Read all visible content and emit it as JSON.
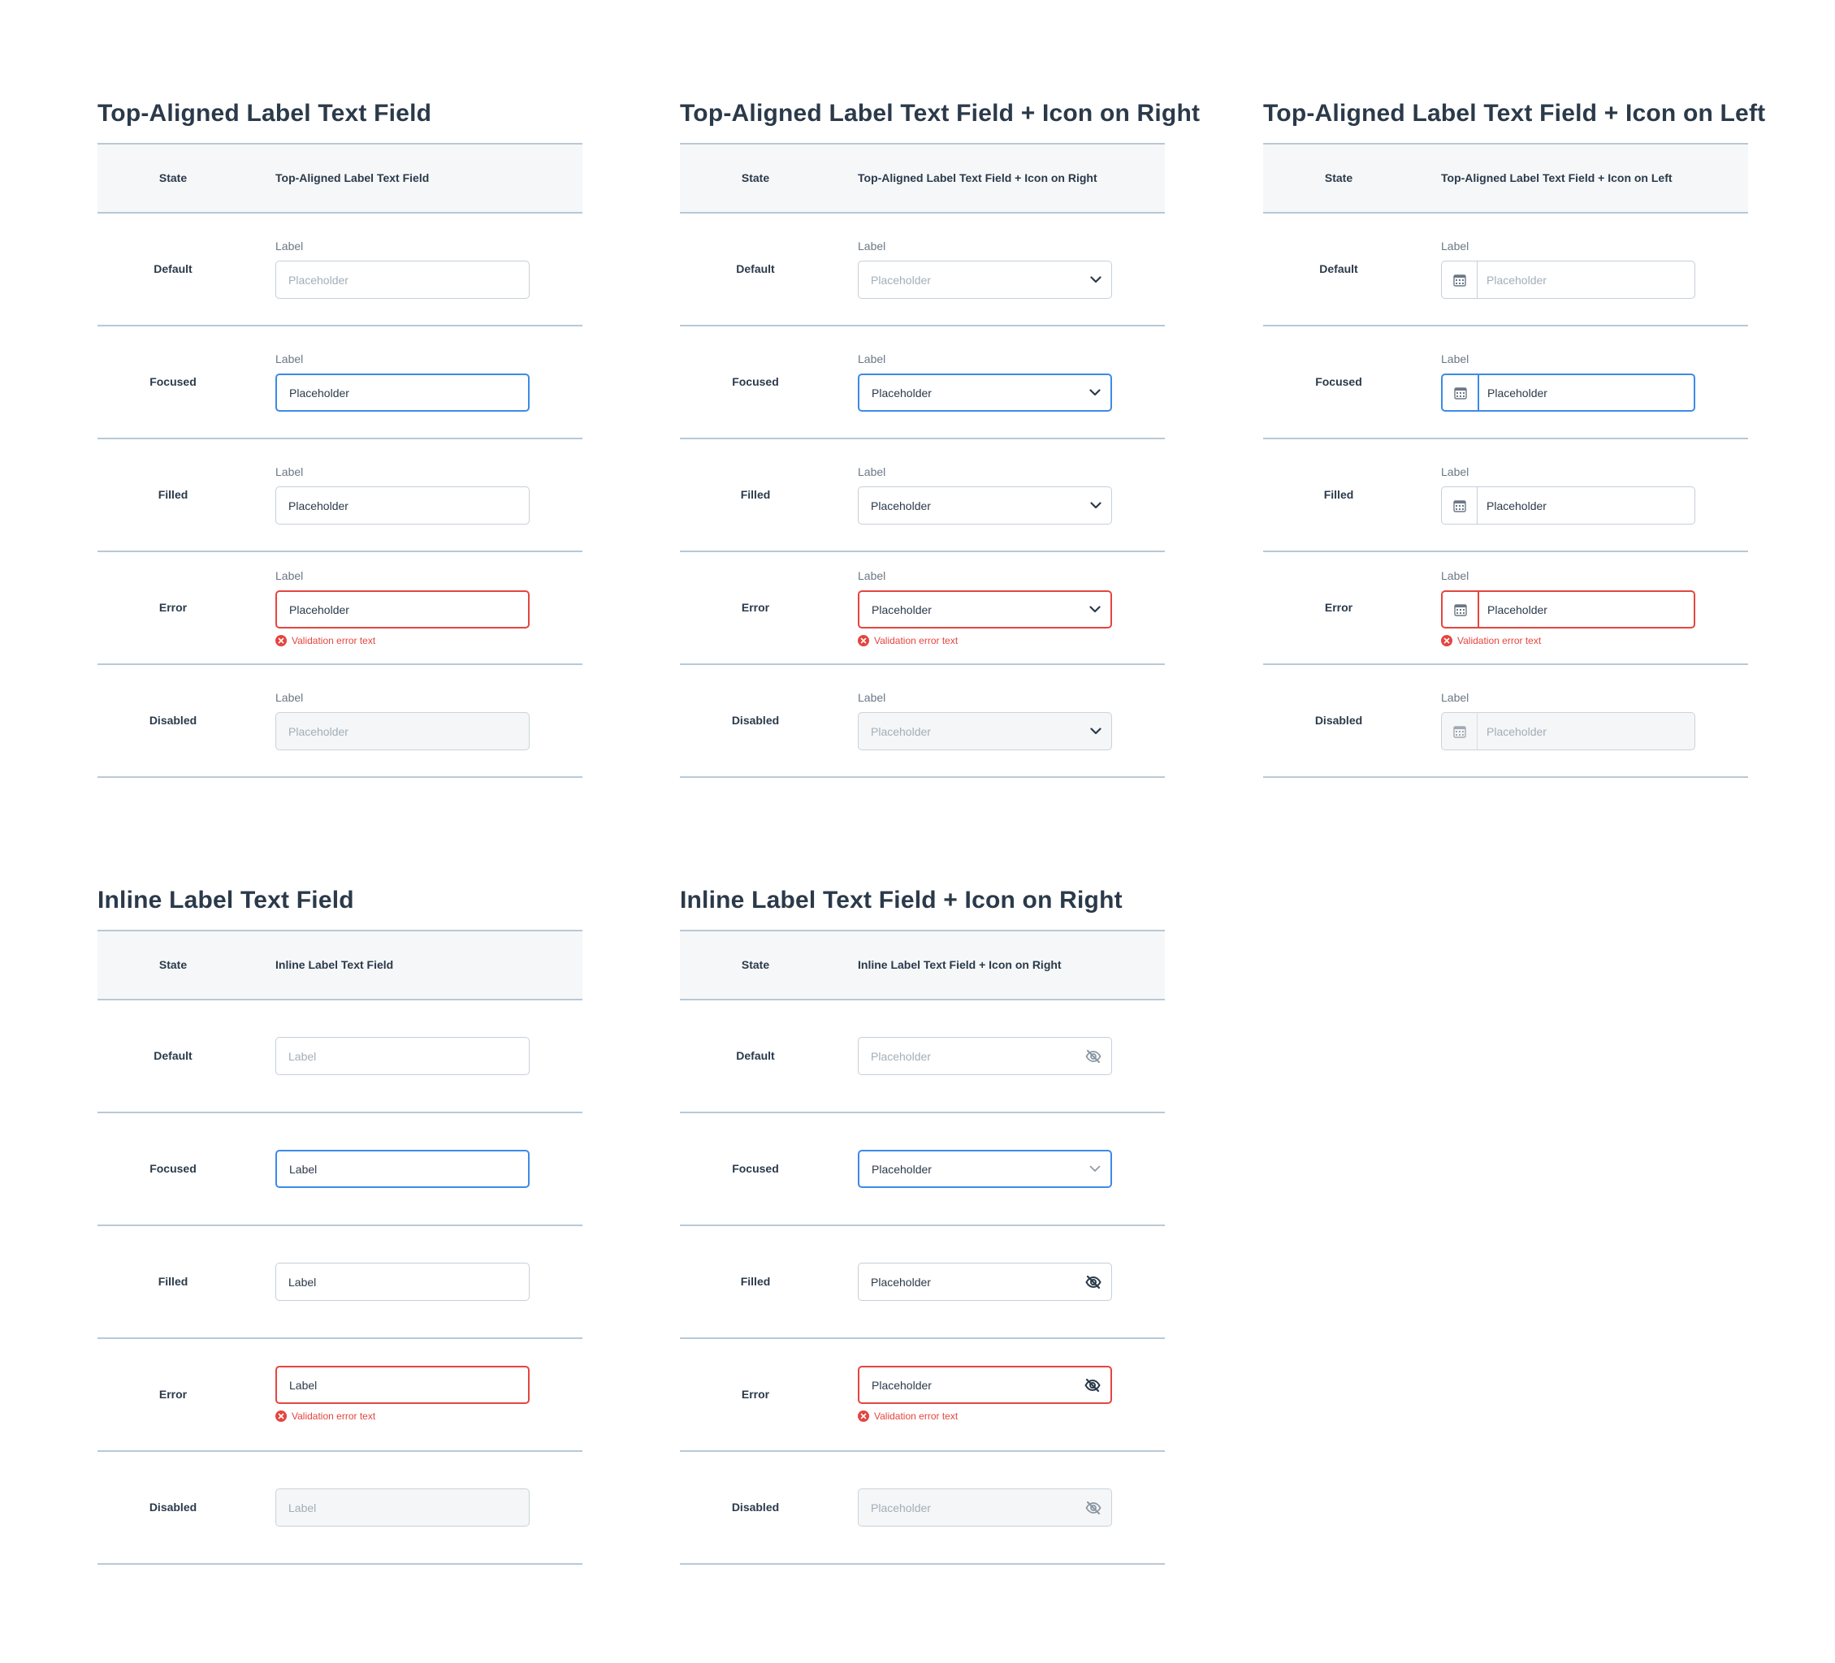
{
  "colors": {
    "focus": "#3c8ae8",
    "error": "#e4453f",
    "border": "#c6cfd8",
    "divider": "#b8c9d8",
    "header_bg": "#f5f7f8",
    "disabled_bg": "#f4f6f7"
  },
  "sections": {
    "top_label": {
      "title": "Top-Aligned Label Text Field",
      "header_state": "State",
      "header_col": "Top-Aligned Label Text Field",
      "rows": [
        {
          "state": "Default",
          "label": "Label",
          "value": "Placeholder"
        },
        {
          "state": "Focused",
          "label": "Label",
          "value": "Placeholder"
        },
        {
          "state": "Filled",
          "label": "Label",
          "value": "Placeholder"
        },
        {
          "state": "Error",
          "label": "Label",
          "value": "Placeholder",
          "error": "Validation error text"
        },
        {
          "state": "Disabled",
          "label": "Label",
          "value": "Placeholder"
        }
      ]
    },
    "top_label_icon_right": {
      "title": "Top-Aligned Label Text Field + Icon on Right",
      "header_state": "State",
      "header_col": "Top-Aligned Label Text Field + Icon on Right",
      "icon": "chevron-down-icon",
      "rows": [
        {
          "state": "Default",
          "label": "Label",
          "value": "Placeholder"
        },
        {
          "state": "Focused",
          "label": "Label",
          "value": "Placeholder"
        },
        {
          "state": "Filled",
          "label": "Label",
          "value": "Placeholder"
        },
        {
          "state": "Error",
          "label": "Label",
          "value": "Placeholder",
          "error": "Validation error text"
        },
        {
          "state": "Disabled",
          "label": "Label",
          "value": "Placeholder"
        }
      ]
    },
    "top_label_icon_left": {
      "title": "Top-Aligned Label Text Field + Icon on Left",
      "header_state": "State",
      "header_col": "Top-Aligned Label Text Field + Icon on Left",
      "icon": "calendar-icon",
      "rows": [
        {
          "state": "Default",
          "label": "Label",
          "value": "Placeholder"
        },
        {
          "state": "Focused",
          "label": "Label",
          "value": "Placeholder"
        },
        {
          "state": "Filled",
          "label": "Label",
          "value": "Placeholder"
        },
        {
          "state": "Error",
          "label": "Label",
          "value": "Placeholder",
          "error": "Validation error text"
        },
        {
          "state": "Disabled",
          "label": "Label",
          "value": "Placeholder"
        }
      ]
    },
    "inline_label": {
      "title": "Inline Label Text Field",
      "header_state": "State",
      "header_col": "Inline Label Text Field",
      "rows": [
        {
          "state": "Default",
          "value": "Label"
        },
        {
          "state": "Focused",
          "value": "Label"
        },
        {
          "state": "Filled",
          "value": "Label"
        },
        {
          "state": "Error",
          "value": "Label",
          "error": "Validation error text"
        },
        {
          "state": "Disabled",
          "value": "Label"
        }
      ]
    },
    "inline_label_icon_right": {
      "title": "Inline Label Text Field + Icon on Right",
      "header_state": "State",
      "header_col": "Inline Label Text Field + Icon on Right",
      "icon": "eye-slash-icon",
      "rows": [
        {
          "state": "Default",
          "value": "Placeholder"
        },
        {
          "state": "Focused",
          "value": "Placeholder"
        },
        {
          "state": "Filled",
          "value": "Placeholder"
        },
        {
          "state": "Error",
          "value": "Placeholder",
          "error": "Validation error text"
        },
        {
          "state": "Disabled",
          "value": "Placeholder"
        }
      ]
    }
  }
}
